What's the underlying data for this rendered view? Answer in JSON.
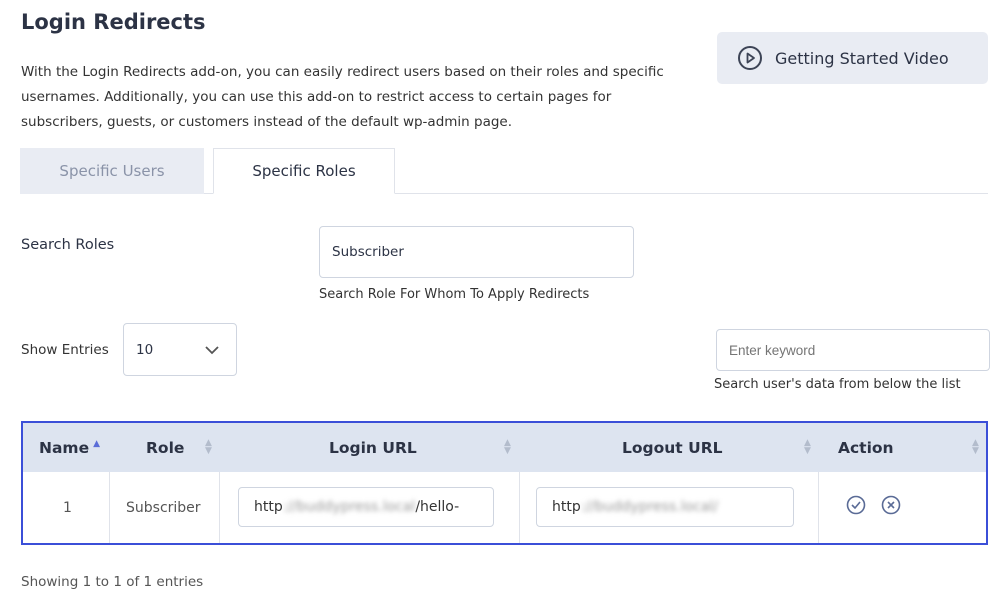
{
  "page_title": "Login Redirects",
  "description": "With the Login Redirects add-on, you can easily redirect users based on their roles and specific usernames. Additionally, you can use this add-on to restrict access to certain pages for subscribers, guests, or customers instead of the default wp-admin page.",
  "video_button": {
    "label": "Getting Started Video",
    "icon": "play-circle-icon"
  },
  "tabs": [
    {
      "label": "Specific Users",
      "active": false
    },
    {
      "label": "Specific Roles",
      "active": true
    }
  ],
  "search_roles": {
    "label": "Search Roles",
    "value": "Subscriber",
    "hint": "Search Role For Whom To Apply Redirects"
  },
  "show_entries": {
    "label": "Show Entries",
    "value": "10"
  },
  "keyword_search": {
    "placeholder": "Enter keyword",
    "hint": "Search user's data from below the list"
  },
  "table": {
    "columns": [
      "Name",
      "Role",
      "Login URL",
      "Logout URL",
      "Action"
    ],
    "rows": [
      {
        "name": "1",
        "role": "Subscriber",
        "login_prefix": "http",
        "login_blurred": "://buddypress.local",
        "login_suffix": "/hello-",
        "logout_prefix": "http",
        "logout_blurred": "://buddypress.local/"
      }
    ]
  },
  "footer": "Showing 1 to 1 of 1 entries",
  "colors": {
    "accent_border": "#3b4fd8",
    "header_bg": "#dde4f0",
    "tab_inactive_bg": "#e9ecf3"
  }
}
